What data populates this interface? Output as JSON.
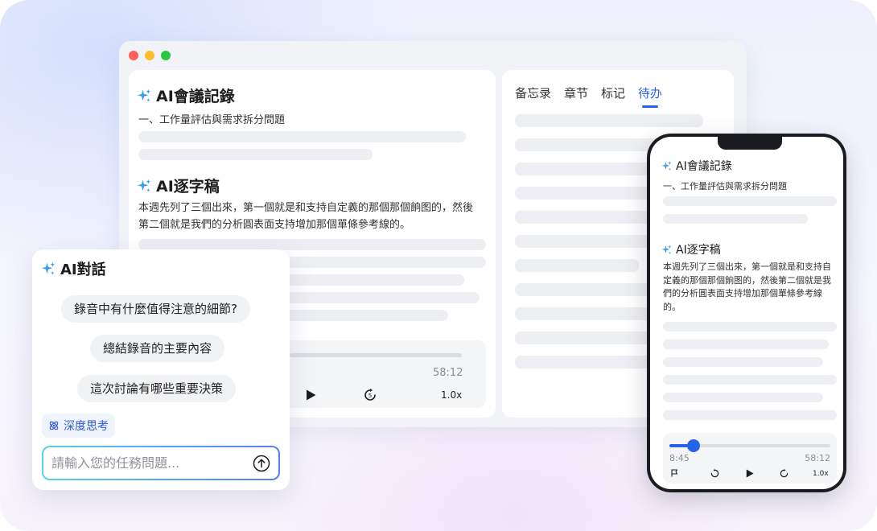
{
  "desktop": {
    "notes_title": "AI會議記錄",
    "notes_sub": "一、工作量評估與需求拆分問題",
    "transcript_title": "AI逐字稿",
    "transcript_text": "本週先列了三個出來，第一個就是和支持自定義的那個那個餉图的，然後第二個就是我們的分析圓表面支持增加那個單條參考線的。",
    "player": {
      "duration": "58:12",
      "speed": "1.0x"
    },
    "tabs": [
      {
        "label": "备忘录"
      },
      {
        "label": "章节"
      },
      {
        "label": "标记"
      },
      {
        "label": "待办",
        "active": true
      }
    ]
  },
  "chat": {
    "title": "AI對話",
    "suggestions": [
      "錄音中有什麼值得注意的細節?",
      "總結錄音的主要內容",
      "這次討論有哪些重要決策"
    ],
    "deep_think": "深度思考",
    "input_placeholder": "請輸入您的任務問題..."
  },
  "phone": {
    "notes_title": "AI會議記錄",
    "notes_sub": "一、工作量評估與需求拆分問題",
    "transcript_title": "AI逐字稿",
    "transcript_text": "本週先列了三個出來，第一個就是和支持自定義的那個那個餉图的，然後第二個就是我們的分析圓表面支持增加那個單條參考線的。",
    "player": {
      "current": "8:45",
      "duration": "58:12",
      "speed": "1.0x",
      "progress": 0.15
    }
  },
  "colors": {
    "accent": "#2563eb",
    "sparkle_start": "#3ad0e8",
    "sparkle_end": "#3a6cf0"
  },
  "icons": [
    "sparkle-icon",
    "play-icon",
    "forward-5-icon",
    "rewind-icon",
    "flag-icon",
    "atom-icon",
    "send-up-arrow-icon"
  ]
}
